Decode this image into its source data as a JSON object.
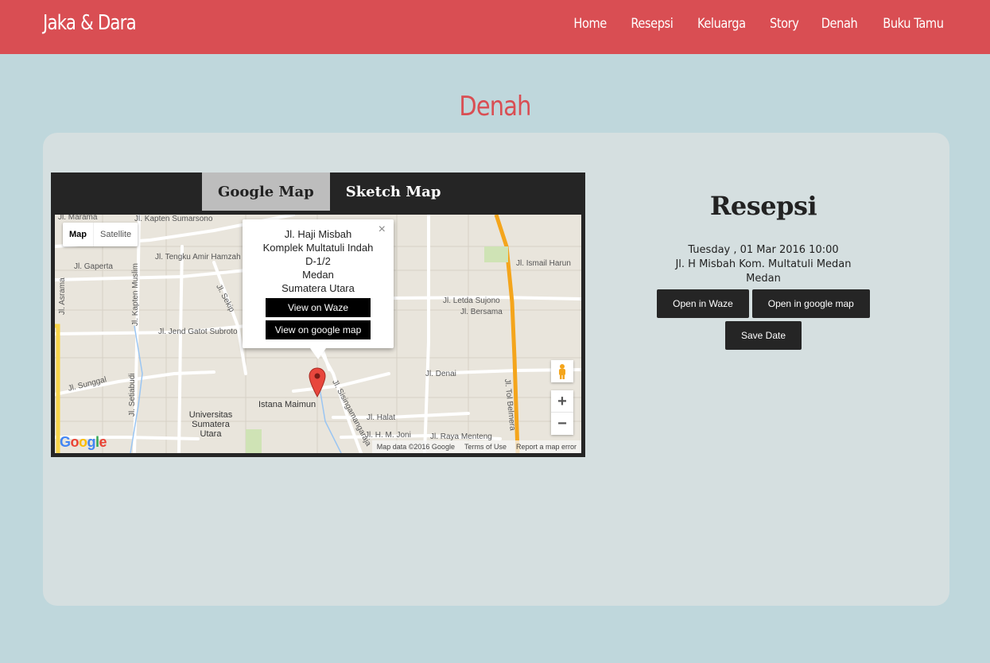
{
  "brand": "Jaka & Dara",
  "nav": [
    "Home",
    "Resepsi",
    "Keluarga",
    "Story",
    "Denah",
    "Buku Tamu"
  ],
  "section_title": "Denah",
  "map_tabs": {
    "google": "Google Map",
    "sketch": "Sketch Map"
  },
  "map": {
    "type_map": "Map",
    "type_satellite": "Satellite",
    "roads": {
      "kapten_sumarsono": "Jl. Kapten Sumarsono",
      "tengku_amir_hamzah": "Jl. Tengku Amir Hamzah",
      "gaperta": "Jl. Gaperta",
      "kapten_muslim": "Jl. Kapten Muslim",
      "asrama": "Jl. Asrama",
      "jend_gatot_subroto": "Jl. Jend Gatot Subroto",
      "sekip": "Jl. Sekip",
      "sunggal": "Jl. Sunggal",
      "setiabudi": "Jl. Setiabudi",
      "ismail_harun": "Jl. Ismail Harun",
      "letda_sujono": "Jl. Letda Sujono",
      "bersama": "Jl. Bersama",
      "denai": "Jl. Denai",
      "sisingamangaraja": "Jl. Sisingamangaraja",
      "halat": "Jl. Halat",
      "h_m_joni": "Jl. H. M. Joni",
      "raya_menteng": "Jl. Raya Menteng",
      "tol_belmera": "Jl. Tol Belmera",
      "top_edge": "Jl. Marama"
    },
    "places": {
      "istana_maimun": "Istana Maimun",
      "usu": "Universitas Sumatera Utara"
    },
    "infowindow": {
      "lines": [
        "Jl. Haji Misbah",
        "Komplek Multatuli Indah",
        "D-1/2",
        "Medan",
        "Sumatera Utara"
      ],
      "waze_label": "View on Waze",
      "gmap_label": "View on google map",
      "close": "×"
    },
    "zoom_in": "+",
    "zoom_out": "−",
    "logo": "Google",
    "attribution": {
      "data": "Map data ©2016 Google",
      "terms": "Terms of Use",
      "report": "Report a map error"
    }
  },
  "event": {
    "title": "Resepsi",
    "datetime": "Tuesday , 01 Mar 2016 10:00",
    "address": "Jl. H Misbah Kom. Multatuli Medan",
    "city": "Medan",
    "btn_waze": "Open in Waze",
    "btn_gmap": "Open in google map",
    "btn_save": "Save Date"
  },
  "colors": {
    "accent": "#d94e53",
    "bg": "#bfd7dc",
    "card": "#d5dfe0",
    "dark": "#252525"
  }
}
